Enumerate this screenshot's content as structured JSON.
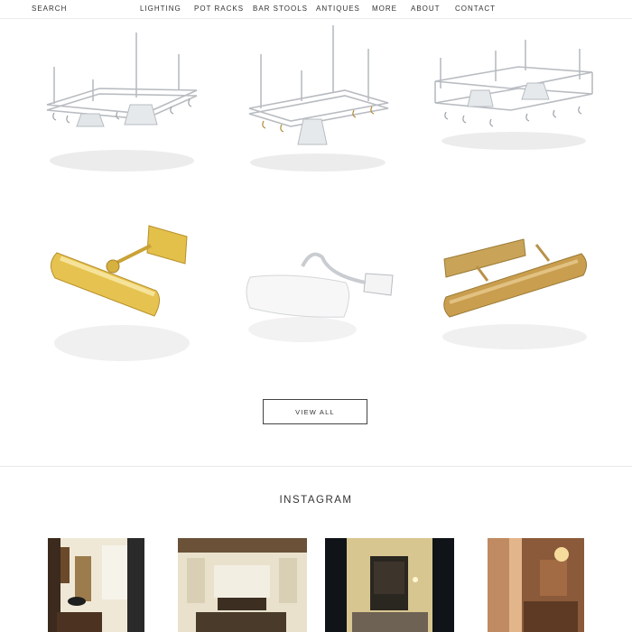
{
  "header": {
    "search_label": "SEARCH",
    "nav": [
      {
        "label": "LIGHTING"
      },
      {
        "label": "POT RACKS"
      },
      {
        "label": "BAR STOOLS"
      },
      {
        "label": "ANTIQUES"
      },
      {
        "label": "MORE"
      },
      {
        "label": "ABOUT"
      },
      {
        "label": "CONTACT"
      }
    ]
  },
  "products": {
    "pot_racks": [
      {
        "name": "pot-rack-nickel-with-two-lights"
      },
      {
        "name": "pot-rack-nickel-with-one-light"
      },
      {
        "name": "pot-rack-nickel-double-tier"
      }
    ],
    "picture_lights": [
      {
        "name": "picture-light-polished-brass"
      },
      {
        "name": "picture-light-white"
      },
      {
        "name": "picture-light-antique-brass"
      }
    ],
    "view_all_label": "VIEW ALL"
  },
  "instagram": {
    "title": "INSTAGRAM",
    "photos": [
      {
        "name": "interior-hallway-photo"
      },
      {
        "name": "interior-kitchen-photo"
      },
      {
        "name": "interior-corridor-photo"
      },
      {
        "name": "interior-living-room-photo"
      }
    ]
  },
  "colors": {
    "accent": "#333333",
    "brass": "#d8b24a",
    "nickel": "#c9cdd1",
    "divider": "#e8e8e8"
  }
}
